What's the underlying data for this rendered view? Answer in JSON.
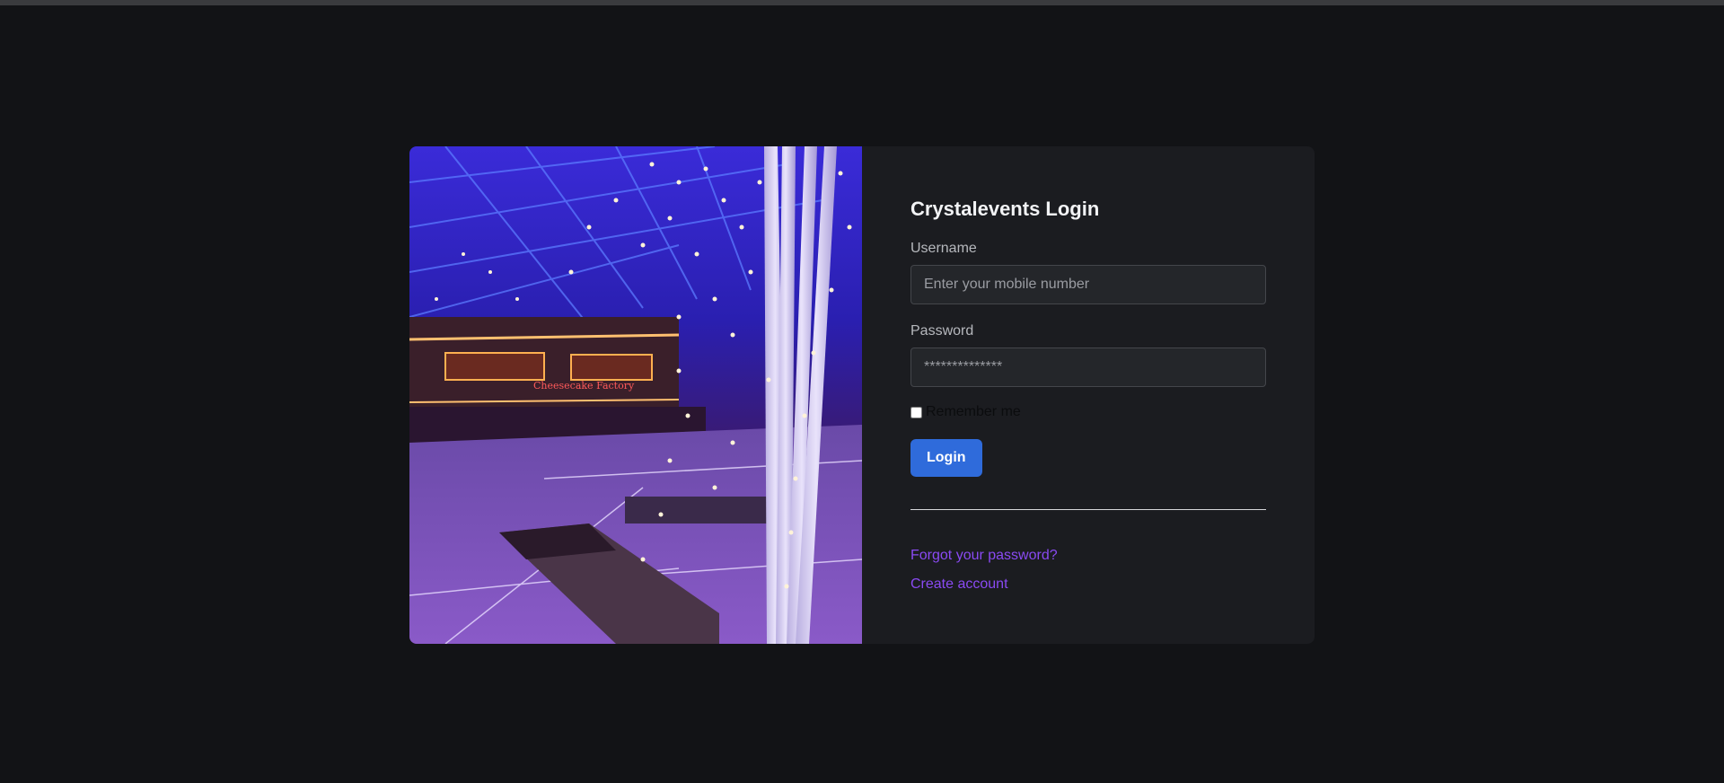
{
  "login": {
    "title": "Crystalevents Login",
    "username_label": "Username",
    "username_placeholder": "Enter your mobile number",
    "password_label": "Password",
    "password_placeholder": "**************",
    "remember_label": "Remember me",
    "login_button": "Login",
    "forgot_link": "Forgot your password?",
    "create_link": "Create account"
  },
  "colors": {
    "background": "#121316",
    "card": "#1b1c20",
    "primary_button": "#2f6bdb",
    "link": "#8a4af3"
  },
  "image": {
    "icon": "illuminated-atrium-photo"
  }
}
